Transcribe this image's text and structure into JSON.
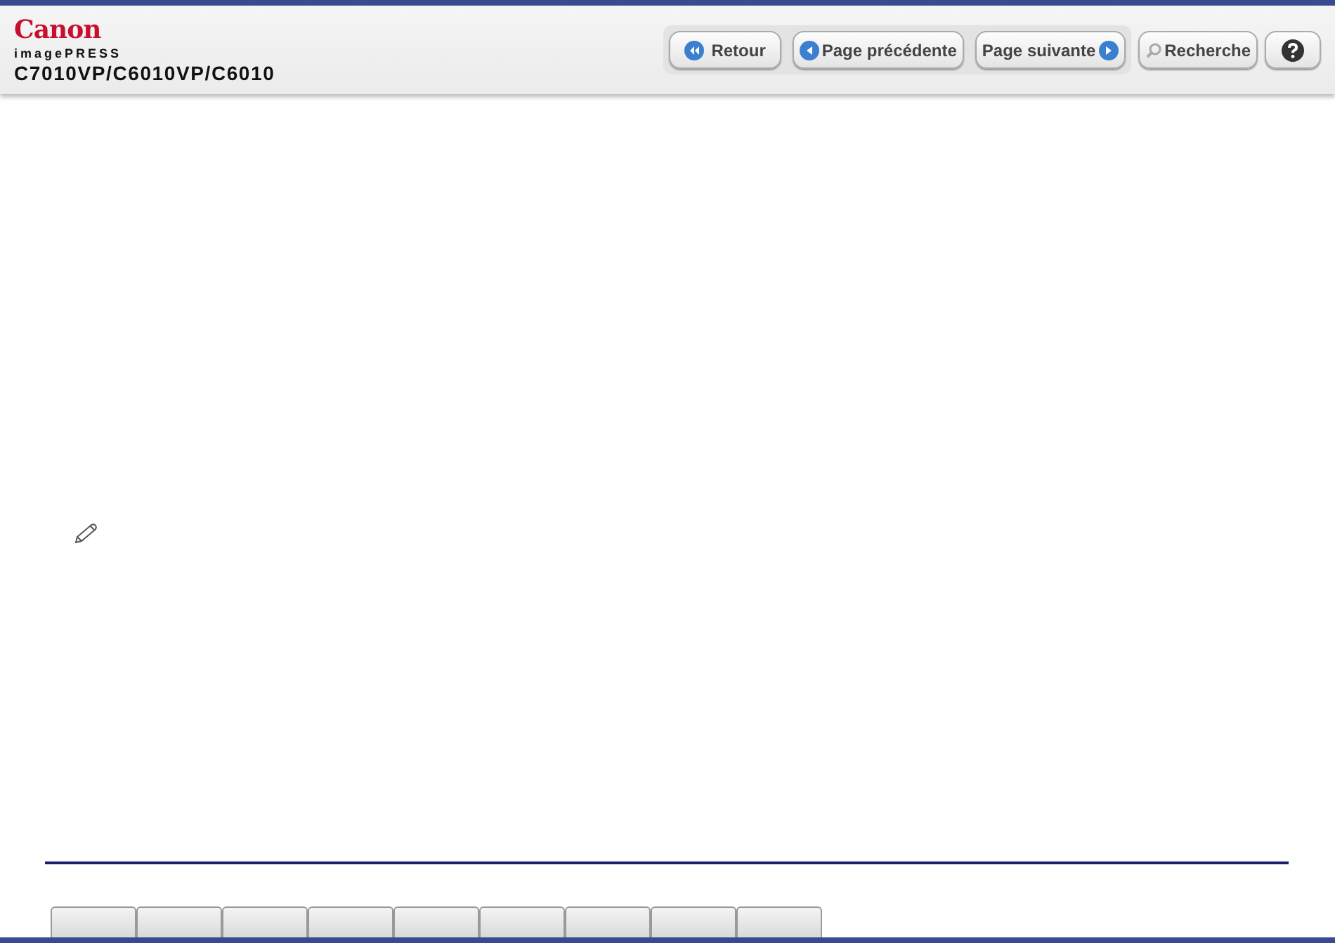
{
  "header": {
    "logo": "Canon",
    "product_line": "imagePRESS",
    "model": "C7010VP/C6010VP/C6010"
  },
  "nav_buttons": [
    {
      "kind": "back",
      "label": "Retour"
    },
    {
      "kind": "prev",
      "label": "Page précédente"
    },
    {
      "kind": "next",
      "label": "Page suivante"
    },
    {
      "kind": "search",
      "label": "Recherche"
    },
    {
      "kind": "help"
    }
  ],
  "content": {
    "icons": [
      {
        "kind": "note"
      }
    ]
  },
  "bottom_tabs": [
    {
      "kind": "tab"
    },
    {
      "kind": "tab"
    },
    {
      "kind": "tab"
    },
    {
      "kind": "tab"
    },
    {
      "kind": "tab"
    },
    {
      "kind": "tab"
    },
    {
      "kind": "tab"
    },
    {
      "kind": "tab"
    },
    {
      "kind": "tab"
    }
  ]
}
